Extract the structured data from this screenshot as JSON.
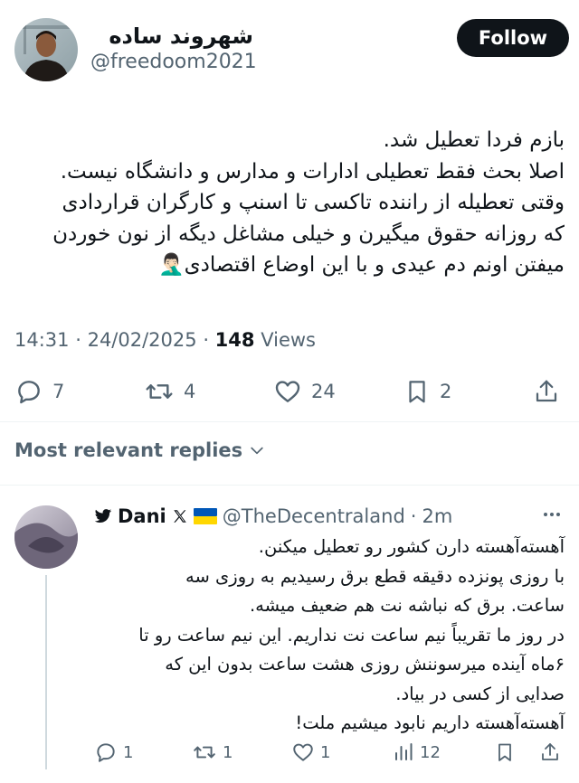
{
  "tweet": {
    "author_name": "شهروند ساده",
    "author_handle": "@freedoom2021",
    "follow_label": "Follow",
    "text_lines": [
      "بازم فردا تعطیل شد.",
      "اصلا بحث فقط تعطیلی ادارات و مدارس و دانشگاه نیست.",
      "وقتی تعطیله از راننده تاکسی تا اسنپ و کارگران قراردادی",
      "که روزانه حقوق میگیرن و خیلی مشاغل دیگه از نون خوردن",
      "میفتن اونم دم عیدی و با این اوضاع اقتصادی🤦🏻‍♂️"
    ],
    "time": "14:31",
    "date": "24/02/2025",
    "views_count": "148",
    "views_label": "Views",
    "stats": {
      "replies": "7",
      "reposts": "4",
      "likes": "24",
      "bookmarks": "2"
    }
  },
  "replies_filter": {
    "label": "Most relevant replies"
  },
  "reply": {
    "author_name": "Dani",
    "flag": "🇺🇦",
    "author_handle": "@TheDecentraland",
    "time_ago": "2m",
    "text_lines": [
      "آهسته‌آهسته دارن کشور رو تعطیل میکنن.",
      "با روزی پونزده دقیقه قطع برق رسیدیم به روزی سه",
      "ساعت. برق که نباشه نت هم ضعیف میشه.",
      "در روز ما تقریباً نیم ساعت نت نداریم. این نیم ساعت رو تا",
      "۶ماه آینده میرسوننش روزی هشت ساعت بدون این که",
      "صدایی از کسی در بیاد.",
      "آهسته‌آهسته داریم نابود میشیم ملت!"
    ],
    "stats": {
      "replies": "1",
      "reposts": "1",
      "likes": "1",
      "views": "12"
    }
  },
  "colors": {
    "text_primary": "#0f1419",
    "text_secondary": "#536471",
    "divider": "#eff3f4",
    "follow_bg": "#0f1419",
    "flag_blue": "#0057b7",
    "flag_yellow": "#ffd700"
  },
  "icons": [
    "reply-icon",
    "repost-icon",
    "like-icon",
    "bookmark-icon",
    "share-icon",
    "views-icon",
    "more-icon",
    "chevron-down-icon",
    "x-logo-icon",
    "verified-badge-icon"
  ]
}
